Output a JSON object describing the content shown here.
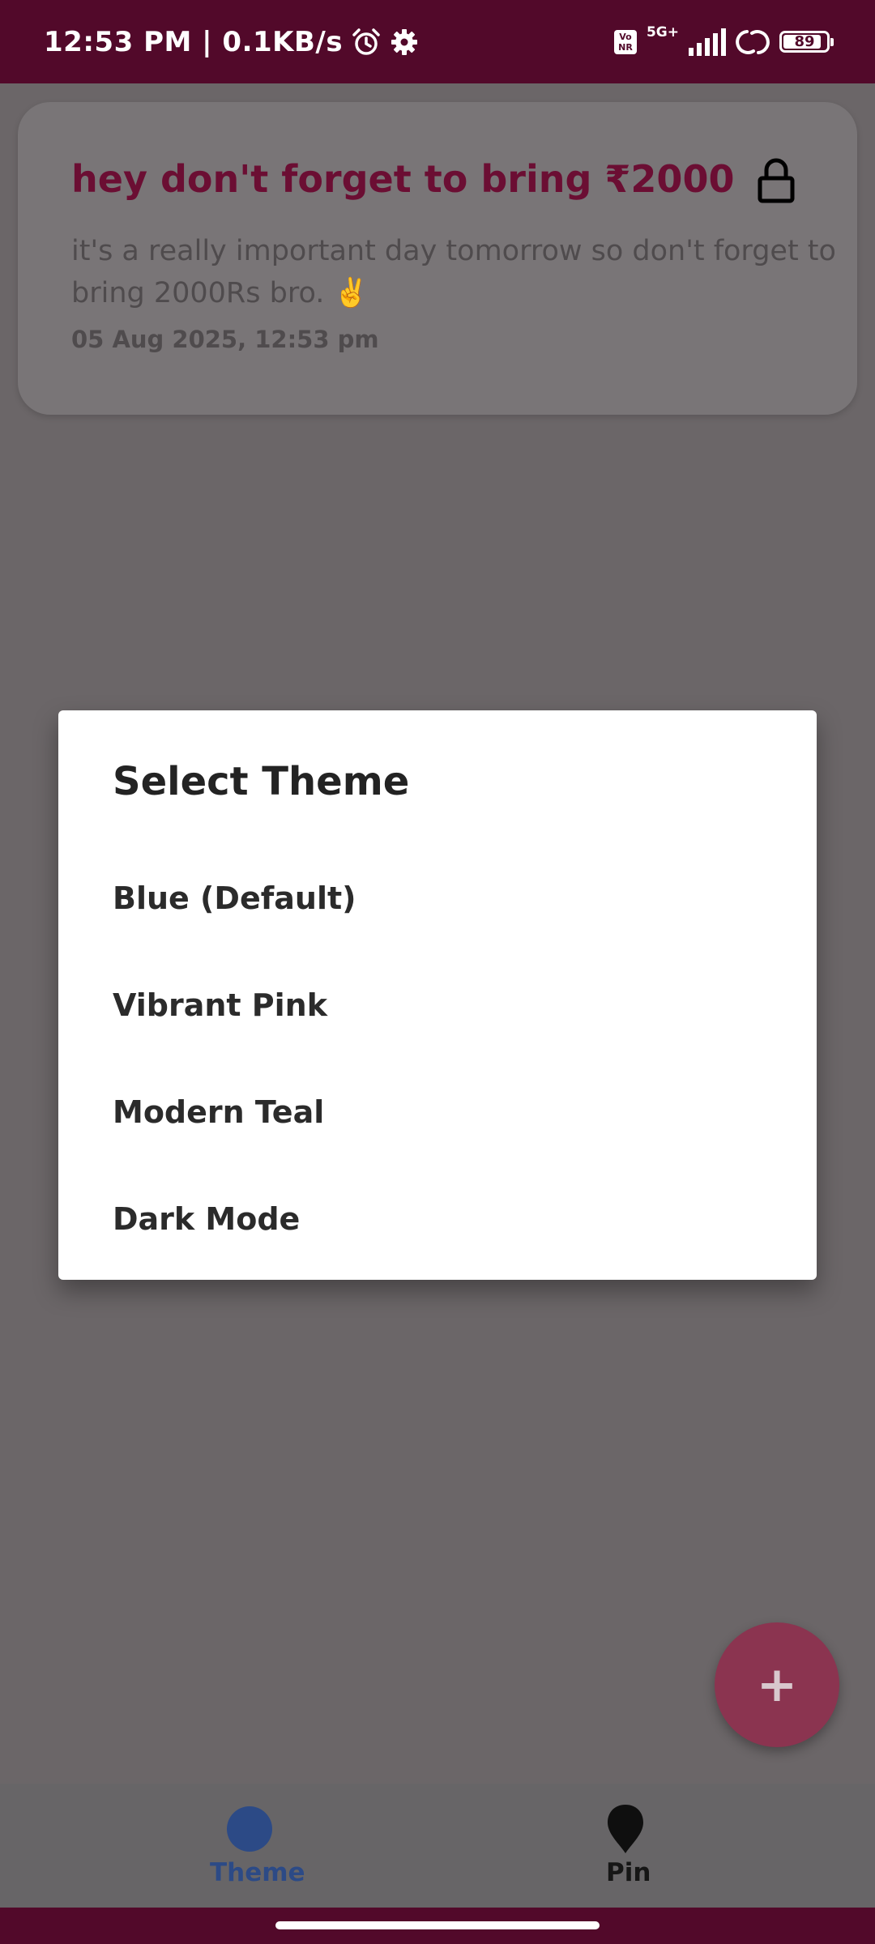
{
  "status_bar": {
    "time_speed": "12:53 PM | 0.1KB/s",
    "volte_label": "Vo NR",
    "network_type": "5G+",
    "battery_level": "89",
    "battery_fraction": 0.89,
    "icons": [
      "alarm-icon",
      "settings-icon",
      "signal-icon",
      "hotspot-icon",
      "battery-icon"
    ]
  },
  "note": {
    "title": "hey don't forget to bring ₹2000",
    "body": "it's a really important day tomorrow so don't forget to bring 2000Rs bro. ✌️",
    "date": "05 Aug 2025, 12:53 pm",
    "icon": "lock-icon"
  },
  "dialog": {
    "title": "Select Theme",
    "options": [
      {
        "label": "Blue (Default)"
      },
      {
        "label": "Vibrant Pink"
      },
      {
        "label": "Modern Teal"
      },
      {
        "label": "Dark Mode"
      }
    ]
  },
  "fab": {
    "label": "+"
  },
  "bottom_nav": {
    "items": [
      {
        "label": "Theme",
        "icon": "theme-dot-icon",
        "active": true
      },
      {
        "label": "Pin",
        "icon": "pin-icon",
        "active": false
      }
    ]
  },
  "colors": {
    "status_bar": "#52092a",
    "note_title": "#6b0e33",
    "theme_accent": "#2c4a86",
    "fab": "#8b3450",
    "scrim": "#6b6668"
  }
}
